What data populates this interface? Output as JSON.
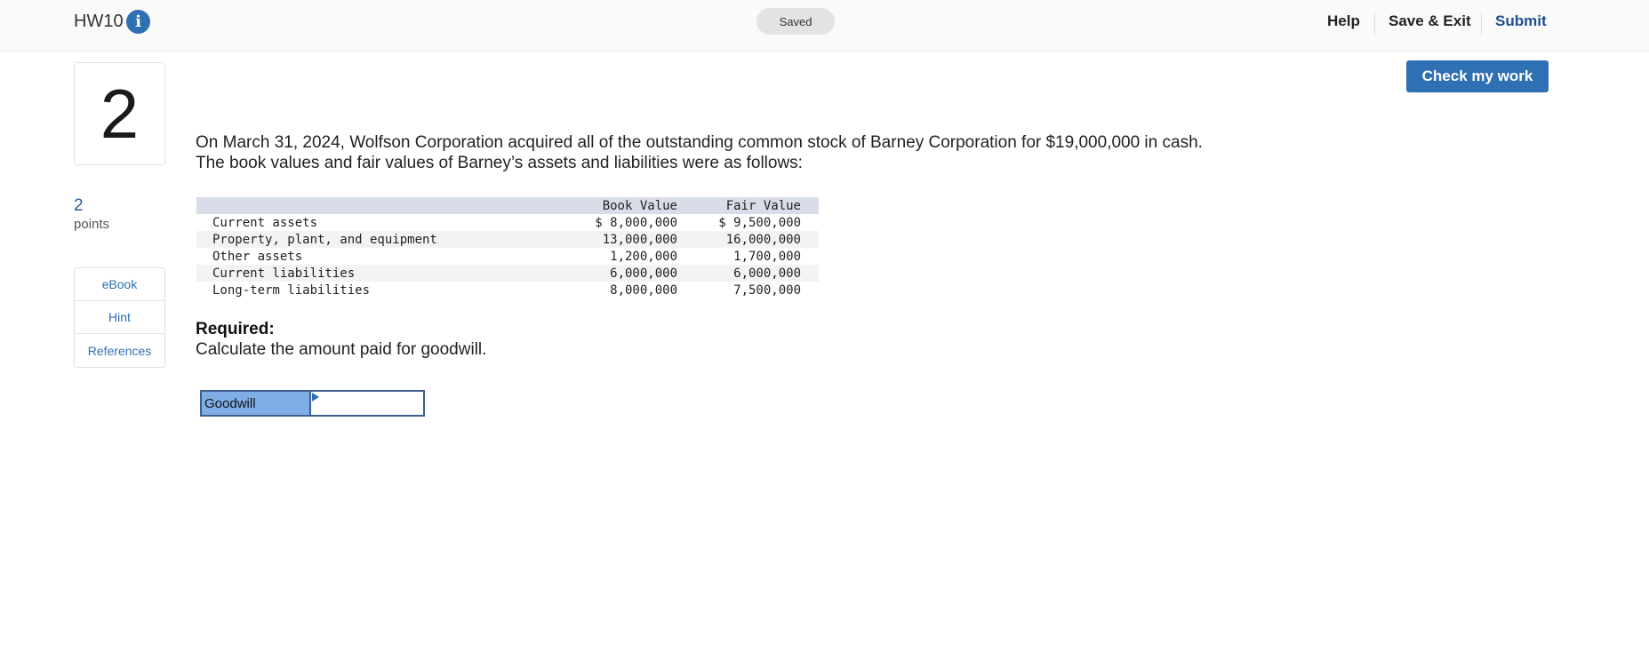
{
  "header": {
    "assignment_title": "HW10",
    "info_icon": "info-icon",
    "status": "Saved",
    "help_label": "Help",
    "save_exit_label": "Save & Exit",
    "submit_label": "Submit"
  },
  "check_button_label": "Check my work",
  "question": {
    "number": "2",
    "points_value": "2",
    "points_label": "points",
    "prompt_line1": "On March 31, 2024, Wolfson Corporation acquired all of the outstanding common stock of Barney Corporation for $19,000,000 in cash.",
    "prompt_line2": "The book values and fair values of Barney’s assets and liabilities were as follows:"
  },
  "resources": [
    "eBook",
    "Hint",
    "References"
  ],
  "table": {
    "headers": {
      "label": "",
      "book": "Book Value",
      "fair": "Fair Value"
    },
    "rows": [
      {
        "label": "Current assets",
        "book": "$ 8,000,000",
        "fair": "$ 9,500,000"
      },
      {
        "label": "Property, plant, and equipment",
        "book": "13,000,000",
        "fair": "16,000,000"
      },
      {
        "label": "Other assets",
        "book": "1,200,000",
        "fair": "1,700,000"
      },
      {
        "label": "Current liabilities",
        "book": "6,000,000",
        "fair": "6,000,000"
      },
      {
        "label": "Long-term liabilities",
        "book": "8,000,000",
        "fair": "7,500,000"
      }
    ]
  },
  "required": {
    "heading": "Required:",
    "text": "Calculate the amount paid for goodwill."
  },
  "answer": {
    "label": "Goodwill",
    "value": ""
  },
  "colors": {
    "accent": "#2f6fb3",
    "answer_label_bg": "#7faee6",
    "table_header_bg": "#d9dde8"
  }
}
